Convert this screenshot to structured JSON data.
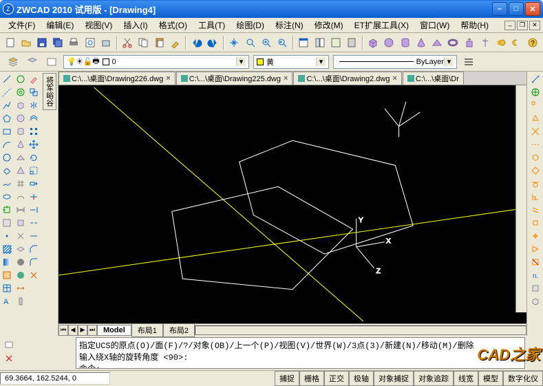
{
  "title": "ZWCAD 2010 试用版 - [Drawing4]",
  "menus": [
    "文件(F)",
    "编辑(E)",
    "视图(V)",
    "插入(I)",
    "格式(O)",
    "工具(T)",
    "绘图(D)",
    "标注(N)",
    "修改(M)",
    "ET扩展工具(X)",
    "窗口(W)",
    "帮助(H)"
  ],
  "layer": {
    "current": "0",
    "color": "黄",
    "linetype": "ByLayer"
  },
  "tabs": [
    "C:\\...\\桌面\\Drawing226.dwg",
    "C:\\...\\桌面\\Drawing225.dwg",
    "C:\\...\\桌面\\Drawing2.dwg",
    "C:\\...\\桌面\\Dr"
  ],
  "vtab": "将军峪谷",
  "layout_tabs": {
    "model": "Model",
    "l1": "布局1",
    "l2": "布局2"
  },
  "cmd": {
    "line1": "指定UCS的原点(O)/面(F)/?/对象(OB)/上一个(P)/视图(V)/世界(W)/3点(3)/新建(N)/移动(M)/删除",
    "line2": "输入绕X轴的旋转角度 <90>:",
    "prompt": "命令:"
  },
  "coords": "69.3664, 162.5244, 0",
  "status_btns": [
    "捕捉",
    "栅格",
    "正交",
    "极轴",
    "对象捕捉",
    "对象追踪",
    "线宽",
    "模型",
    "数字化仪"
  ],
  "watermark": "CAD之家",
  "axis": {
    "x": "X",
    "y": "Y",
    "z": "Z"
  }
}
